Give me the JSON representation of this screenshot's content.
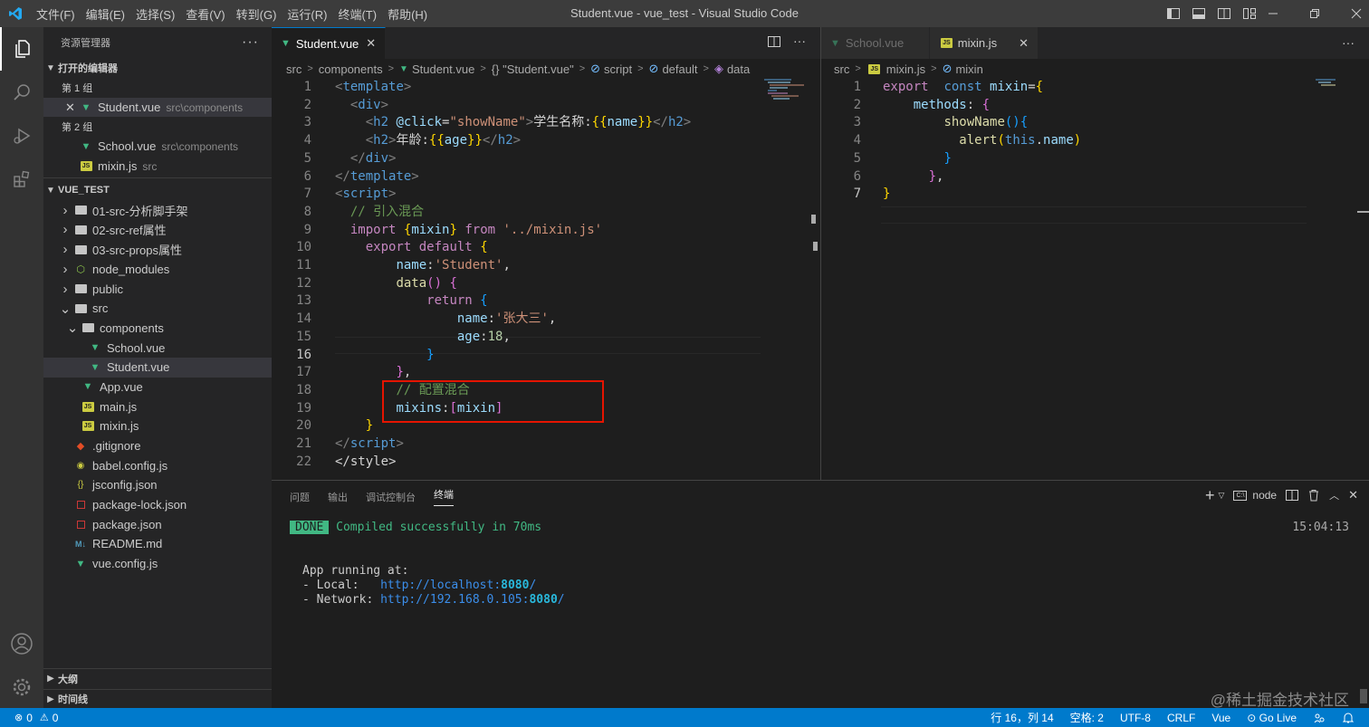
{
  "titlebar": {
    "menu": [
      "文件(F)",
      "编辑(E)",
      "选择(S)",
      "查看(V)",
      "转到(G)",
      "运行(R)",
      "终端(T)",
      "帮助(H)"
    ],
    "title": "Student.vue - vue_test - Visual Studio Code"
  },
  "sidebar": {
    "header": "资源管理器",
    "open_editors": "打开的编辑器",
    "group1": "第 1 组",
    "group2": "第 2 组",
    "open_files": [
      {
        "name": "Student.vue",
        "desc": "src\\components"
      },
      {
        "name": "School.vue",
        "desc": "src\\components"
      },
      {
        "name": "mixin.js",
        "desc": "src"
      }
    ],
    "project": "VUE_TEST",
    "tree": [
      "01-src-分析脚手架",
      "02-src-ref属性",
      "03-src-props属性",
      "node_modules",
      "public",
      "src",
      "components",
      "School.vue",
      "Student.vue",
      "App.vue",
      "main.js",
      "mixin.js",
      ".gitignore",
      "babel.config.js",
      "jsconfig.json",
      "package-lock.json",
      "package.json",
      "README.md",
      "vue.config.js"
    ],
    "outline": "大纲",
    "timeline": "时间线"
  },
  "editor1": {
    "tab": "Student.vue",
    "breadcrumb": [
      "src",
      "components",
      "Student.vue",
      "{} \"Student.vue\"",
      "script",
      "default",
      "data"
    ]
  },
  "editor2": {
    "tabs": [
      "School.vue",
      "mixin.js"
    ],
    "breadcrumb": [
      "src",
      "mixin.js",
      "mixin"
    ]
  },
  "panel": {
    "tabs": [
      "问题",
      "输出",
      "调试控制台",
      "终端"
    ],
    "terminal_name": "node",
    "done": "DONE",
    "compiled": "Compiled successfully in 70ms",
    "time": "15:04:13",
    "app_running": "App running at:",
    "local_label": "- Local:   ",
    "local_url_a": "http://localhost:",
    "local_port": "8080",
    "url_end": "/",
    "network_label": "- Network: ",
    "network_url_a": "http://192.168.0.105:",
    "network_port": "8080"
  },
  "watermark": "@稀土掘金技术社区",
  "status": {
    "errors": "0",
    "warnings": "0",
    "position": "行 16，列 14",
    "spaces": "空格: 2",
    "encoding": "UTF-8",
    "eol": "CRLF",
    "language": "Vue",
    "golive": "Go Live"
  },
  "colors": {
    "accent": "#007acc",
    "highlight_box": "#e51400",
    "done_badge": "#41b883"
  }
}
